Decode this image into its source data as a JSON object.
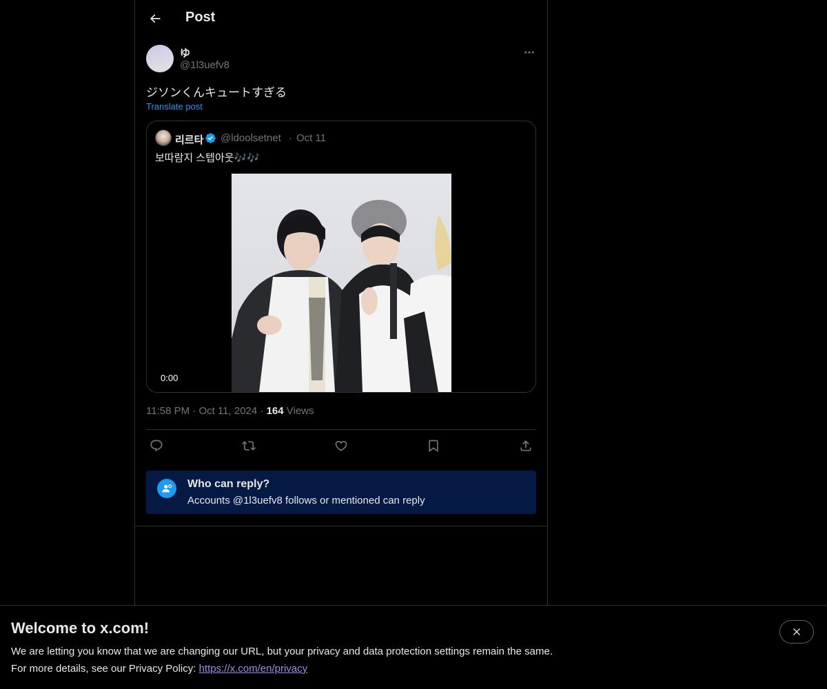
{
  "header": {
    "title": "Post"
  },
  "post": {
    "display_name": "ゆ",
    "handle": "@1l3uefv8",
    "text": "ジソンくんキュートすぎる",
    "translate_label": "Translate post",
    "time": "11:58 PM",
    "date": "Oct 11, 2024",
    "views_count": "164",
    "views_label": "Views",
    "separator": "·"
  },
  "quote": {
    "display_name": "리르타",
    "handle": "@ldoolsetnet",
    "date": "Oct 11",
    "text": "보따람지 스텝아웃🎶🎶",
    "video_time": "0:00",
    "verified": true
  },
  "reply_restriction": {
    "title": "Who can reply?",
    "subtitle": "Accounts @1l3uefv8 follows or mentioned can reply"
  },
  "banner": {
    "title": "Welcome to x.com!",
    "line1": "We are letting you know that we are changing our URL, but your privacy and data protection settings remain the same.",
    "line2_prefix": "For more details, see our Privacy Policy: ",
    "link": "https://x.com/en/privacy"
  },
  "colors": {
    "accent": "#1d9bf0",
    "background": "#000000",
    "border": "#2f3336",
    "muted_text": "#71767b",
    "reply_box": "#041a45",
    "link_visited": "#9a8ef0"
  },
  "icons": {
    "back": "arrow-left-icon",
    "more": "more-horizontal-icon",
    "verified": "verified-badge-icon",
    "reply": "reply-icon",
    "repost": "repost-icon",
    "like": "heart-icon",
    "bookmark": "bookmark-icon",
    "share": "share-icon",
    "reply_restriction": "person-mention-icon",
    "close": "close-icon"
  }
}
